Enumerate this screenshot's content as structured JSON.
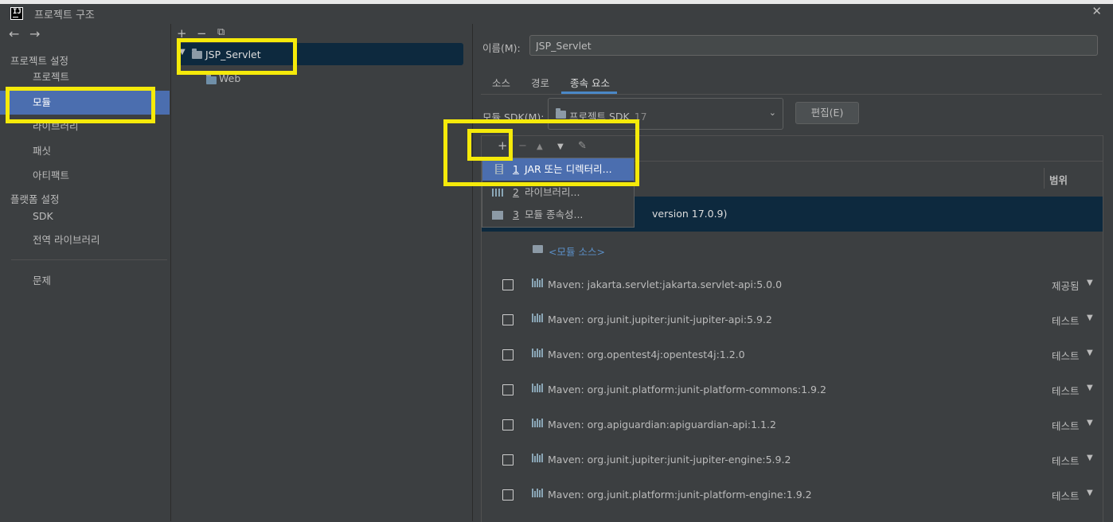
{
  "window": {
    "title": "프로젝트 구조",
    "close": "✕"
  },
  "nav": {
    "back": "←",
    "forward": "→",
    "project_settings": "프로젝트 설정",
    "items": [
      "프로젝트",
      "모듈",
      "라이브러리",
      "패싯",
      "아티팩트"
    ],
    "platform_settings": "플랫폼 설정",
    "platform_items": [
      "SDK",
      "전역 라이브러리"
    ],
    "problems": "문제"
  },
  "middle": {
    "add": "+",
    "remove": "−",
    "copy": "⧉",
    "tree": [
      {
        "label": "JSP_Servlet",
        "expanded": true
      },
      {
        "label": "Web"
      }
    ]
  },
  "module": {
    "name_label": "이름(M):",
    "name_value": "JSP_Servlet",
    "tabs": [
      "소스",
      "경로",
      "종속 요소"
    ],
    "sdk_label": "모듈 SDK(M):",
    "sdk_value": "프로젝트 SDK",
    "sdk_version": "17",
    "edit_button": "편집(E)"
  },
  "deps": {
    "toolbar": {
      "add": "+",
      "remove": "−",
      "up": "▲",
      "down": "▼",
      "edit": "✎"
    },
    "scope_header": "범위",
    "sdk_row": "version 17.0.9)",
    "module_source": "<모듈 소스>",
    "rows": [
      {
        "name": "Maven: jakarta.servlet:jakarta.servlet-api:5.0.0",
        "scope": "제공됨"
      },
      {
        "name": "Maven: org.junit.jupiter:junit-jupiter-api:5.9.2",
        "scope": "테스트"
      },
      {
        "name": "Maven: org.opentest4j:opentest4j:1.2.0",
        "scope": "테스트"
      },
      {
        "name": "Maven: org.junit.platform:junit-platform-commons:1.9.2",
        "scope": "테스트"
      },
      {
        "name": "Maven: org.apiguardian:apiguardian-api:1.1.2",
        "scope": "테스트"
      },
      {
        "name": "Maven: org.junit.jupiter:junit-jupiter-engine:5.9.2",
        "scope": "테스트"
      },
      {
        "name": "Maven: org.junit.platform:junit-platform-engine:1.9.2",
        "scope": "테스트"
      }
    ]
  },
  "popup": {
    "items": [
      {
        "num": "1",
        "label": "JAR 또는 디렉터리..."
      },
      {
        "num": "2",
        "label": "라이브러리..."
      },
      {
        "num": "3",
        "label": "모듈 종속성..."
      }
    ]
  },
  "colors": {
    "highlight": "#f5ea0a",
    "selection": "#4b6eaf",
    "tree_selection": "#0d293e"
  }
}
